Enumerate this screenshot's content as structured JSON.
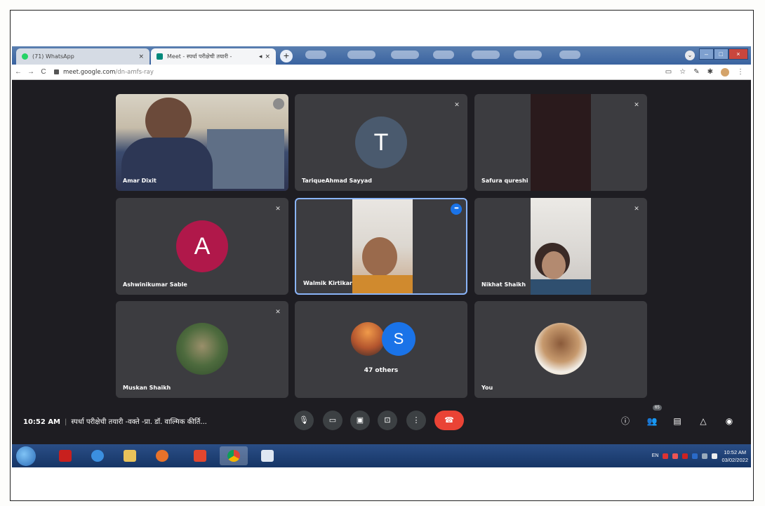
{
  "browser": {
    "tabs": [
      {
        "title": "(71) WhatsApp",
        "close": "×"
      },
      {
        "title": "Meet - स्पर्धा परीक्षेची तयारी -",
        "close": "×"
      }
    ],
    "new_tab": "+",
    "window_controls": {
      "minimize": "–",
      "maximize": "□",
      "close": "×"
    },
    "url_host": "meet.google.com",
    "url_path": "/dn-amfs-ray"
  },
  "participants": [
    {
      "name": "Amar Dixit",
      "avatar_type": "video"
    },
    {
      "name": "TariqueAhmad Sayyad",
      "avatar_type": "letter",
      "letter": "T",
      "color": "#4a5a6e"
    },
    {
      "name": "Safura qureshi",
      "avatar_type": "video"
    },
    {
      "name": "Ashwinikumar Sable",
      "avatar_type": "letter",
      "letter": "A",
      "color": "#b0184a"
    },
    {
      "name": "Walmik Kirtikar",
      "avatar_type": "video",
      "active_speaker": true
    },
    {
      "name": "Nikhat Shaikh",
      "avatar_type": "video"
    },
    {
      "name": "Muskan Shaikh",
      "avatar_type": "photo"
    },
    {
      "name": "47 others",
      "avatar_type": "group",
      "letter": "S",
      "color": "#1a73e8"
    },
    {
      "name": "You",
      "avatar_type": "photo"
    }
  ],
  "meeting": {
    "time": "10:52 AM",
    "separator": "|",
    "title": "स्पर्धा परीक्षेची तयारी -वक्ते -प्रा. डॉ. वाल्मिक कीर्ति..."
  },
  "controls": [
    "mic",
    "camera",
    "captions",
    "present",
    "more",
    "end-call"
  ],
  "people_count": "65",
  "taskbar": {
    "lang": "EN",
    "time": "10:52 AM",
    "date": "03/02/2022"
  },
  "colors": {
    "meet_background": "#1e1d22",
    "tile": "#3c3c40",
    "end_call": "#ea4335",
    "taskbar": "#1f4277"
  }
}
